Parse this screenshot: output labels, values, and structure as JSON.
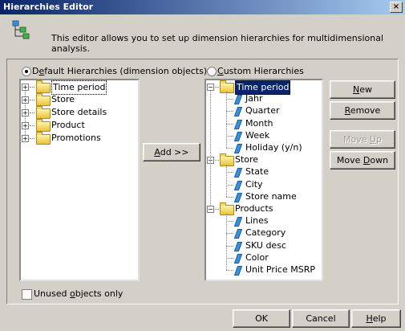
{
  "window": {
    "title": "Hierarchies Editor",
    "close_glyph": "×"
  },
  "header": {
    "description": "This editor allows you to set up dimension hierarchies for multidimensional analysis.",
    "icon": "hierarchy-icon"
  },
  "left_panel": {
    "radio_label_prefix": "D",
    "radio_label_u": "e",
    "radio_label_rest": "fault Hierarchies (dimension objects)",
    "radio_selected": true,
    "items": [
      "Time period",
      "Store",
      "Store details",
      "Product",
      "Promotions"
    ],
    "focused_item": "Time period",
    "checkbox_label_prefix": "Unused ",
    "checkbox_label_u": "o",
    "checkbox_label_rest": "bjects only",
    "checkbox_checked": false
  },
  "add_button": {
    "label_u": "A",
    "label_rest": "dd >>"
  },
  "right_panel": {
    "radio_label_u": "C",
    "radio_label_rest": "ustom Hierarchies",
    "radio_selected": false,
    "groups": [
      {
        "name": "Time period",
        "selected": true,
        "children": [
          "Jahr",
          "Quarter",
          "Month",
          "Week",
          "Holiday (y/n)"
        ]
      },
      {
        "name": "Store",
        "selected": false,
        "children": [
          "State",
          "City",
          "Store name"
        ]
      },
      {
        "name": "Products",
        "selected": false,
        "children": [
          "Lines",
          "Category",
          "SKU desc",
          "Color",
          "Unit Price MSRP"
        ]
      }
    ]
  },
  "side_buttons": {
    "new": {
      "u": "N",
      "rest": "ew",
      "enabled": true
    },
    "remove": {
      "u": "R",
      "rest": "emove",
      "enabled": true
    },
    "move_up": {
      "prefix": "Move ",
      "u": "U",
      "rest": "p",
      "enabled": false
    },
    "move_down": {
      "prefix": "Move ",
      "u": "D",
      "rest": "own",
      "enabled": true
    }
  },
  "footer_buttons": {
    "ok": "OK",
    "cancel": "Cancel",
    "help_u": "H",
    "help_rest": "elp"
  },
  "colors": {
    "dialog_bg": "#d4d0c8",
    "selection": "#0a246a",
    "title_gradient_start": "#0a246a",
    "title_gradient_end": "#a6caf0"
  }
}
